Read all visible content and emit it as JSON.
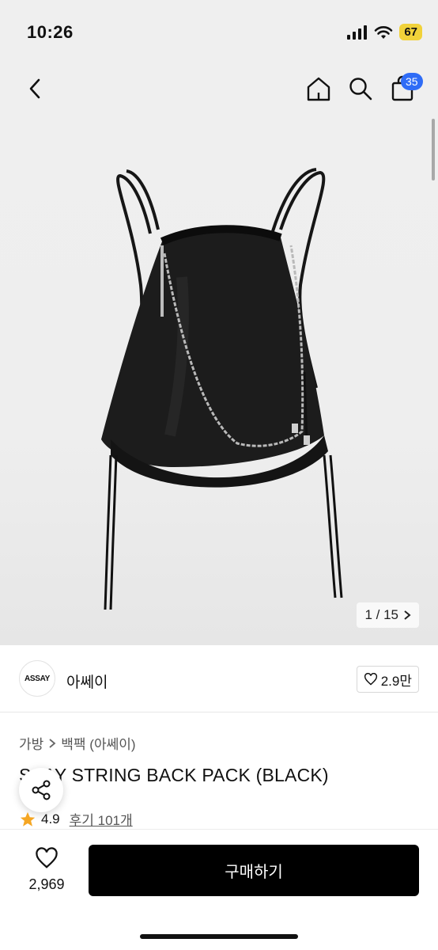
{
  "status_bar": {
    "time": "10:26",
    "battery": "67"
  },
  "header": {
    "cart_count": "35"
  },
  "gallery": {
    "pager": "1 / 15"
  },
  "brand": {
    "logo_text": "ASSAY",
    "name": "아쎄이",
    "likes": "2.9만"
  },
  "product": {
    "breadcrumb": [
      "가방",
      "백팩 (아쎄이)"
    ],
    "title": "SSAY STRING BACK PACK (BLACK)",
    "rating": "4.9",
    "reviews": "후기 101개"
  },
  "bottom_bar": {
    "wish_count": "2,969",
    "buy_label": "구매하기"
  },
  "colors": {
    "accent_badge": "#2f6cf6",
    "star": "#f5a623",
    "buy_button": "#000000"
  }
}
